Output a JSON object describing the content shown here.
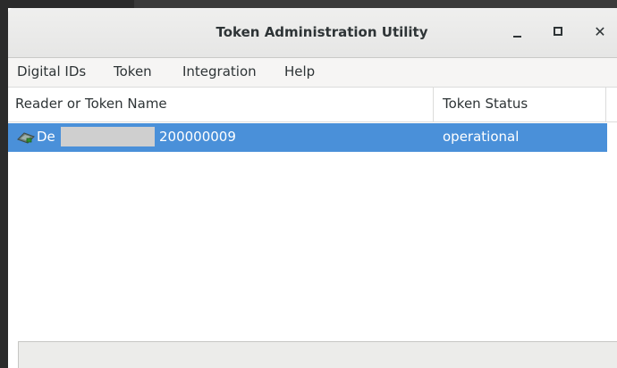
{
  "window": {
    "title": "Token Administration Utility"
  },
  "menubar": {
    "items": [
      {
        "label": "Digital IDs"
      },
      {
        "label": "Token"
      },
      {
        "label": "Integration"
      },
      {
        "label": "Help"
      }
    ]
  },
  "table": {
    "columns": [
      {
        "label": "Reader or Token Name"
      },
      {
        "label": "Token Status"
      }
    ],
    "rows": [
      {
        "name_prefix": "De",
        "name_suffix": "200000009",
        "status": "operational",
        "selected": true,
        "icon": "smartcard-reader-icon"
      }
    ]
  },
  "colors": {
    "selection": "#4a90d9",
    "titlebar": "#e8e8e7",
    "menubar": "#f6f5f4"
  }
}
